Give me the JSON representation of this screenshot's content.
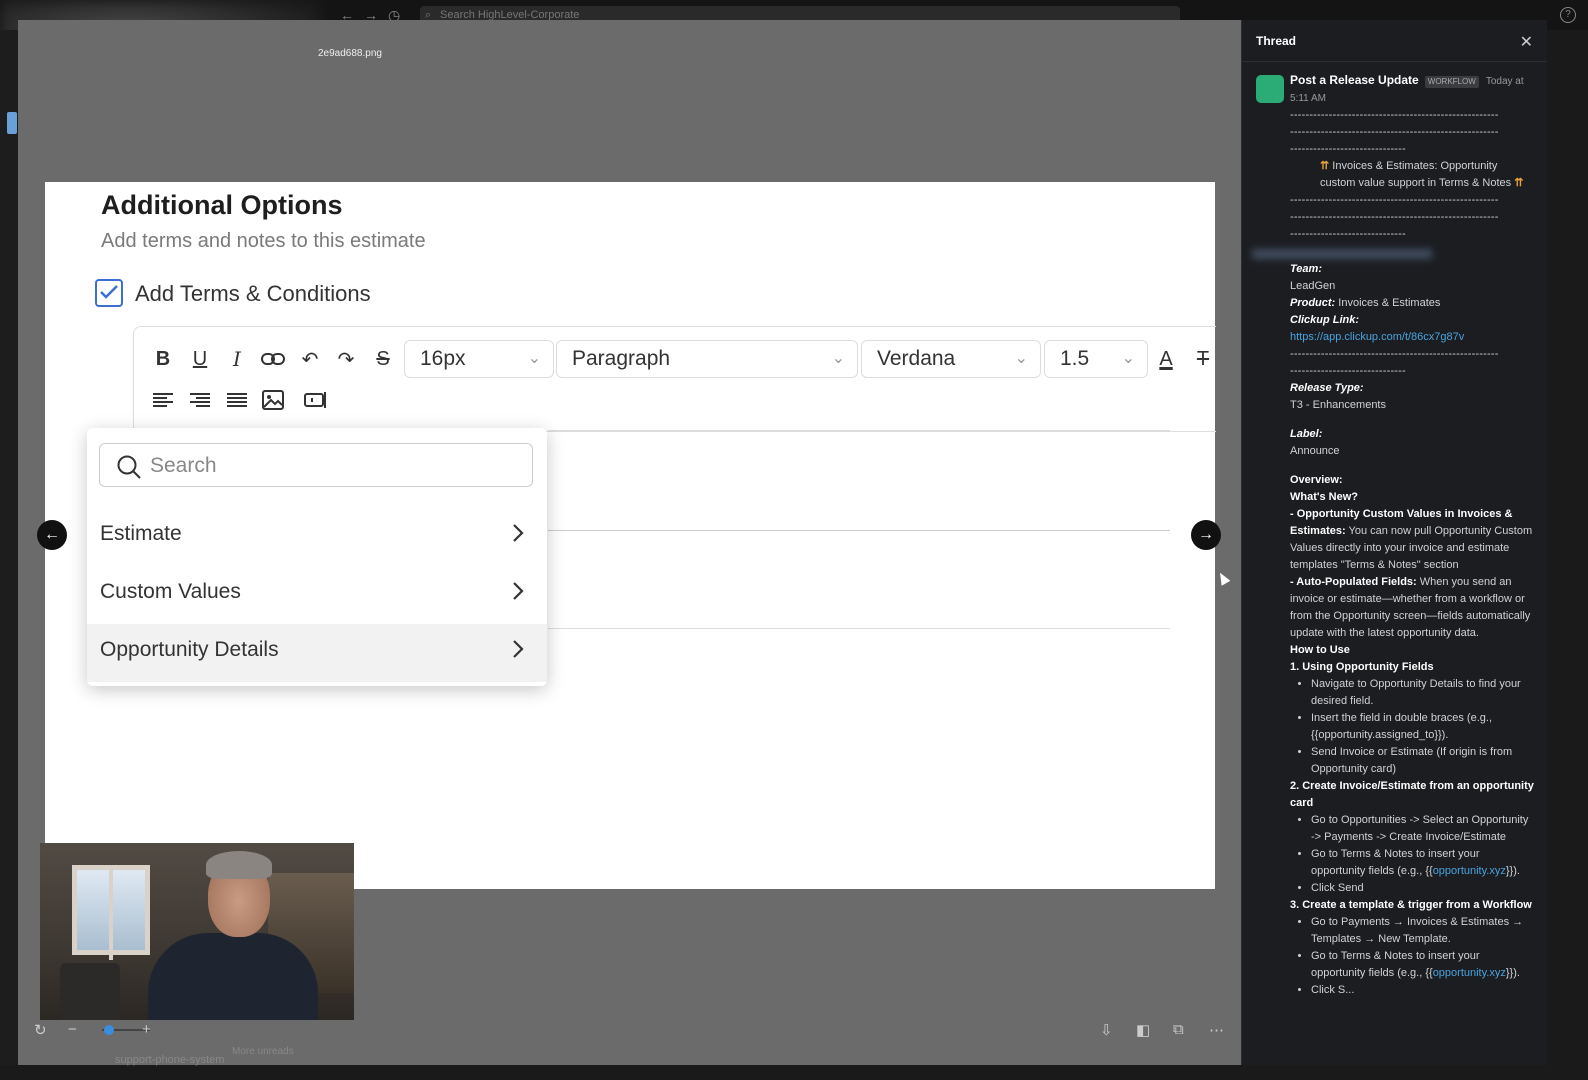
{
  "topbar": {
    "search_placeholder": "Search HighLevel-Corporate"
  },
  "viewer": {
    "file_name": "2e9ad688.png",
    "behind_text": "support-phone-system",
    "behind_text2": "More unreads"
  },
  "panel": {
    "title": "Additional Options",
    "subtitle": "Add terms and notes to this estimate",
    "checkbox_label": "Add Terms & Conditions",
    "checkbox_checked": true,
    "toolbar": {
      "font_size": "16px",
      "block_type": "Paragraph",
      "font_family": "Verdana",
      "line_height": "1.5"
    },
    "dropdown": {
      "search_placeholder": "Search",
      "items": [
        {
          "label": "Estimate"
        },
        {
          "label": "Custom Values"
        },
        {
          "label": "Opportunity Details"
        }
      ]
    }
  },
  "thread": {
    "title": "Thread",
    "sender": "Post a Release Update",
    "badge": "WORKFLOW",
    "time": "Today at 5:11 AM",
    "headline": "Invoices & Estimates: Opportunity custom value support in Terms & Notes",
    "team_label": "Team:",
    "team_value": "LeadGen",
    "product_label": "Product:",
    "product_value": "Invoices & Estimates",
    "clickup_label": "Clickup Link:",
    "clickup_value": "https://app.clickup.com/t/86cx7g87v",
    "release_type_label": "Release Type:",
    "release_type_value": "T3 - Enhancements",
    "label_label": "Label:",
    "label_value": "Announce",
    "overview": "Overview:",
    "whats_new": "What's New?",
    "feature1_title": "- Opportunity Custom Values in Invoices & Estimates:",
    "feature1_text": "You can now pull Opportunity Custom Values directly into your invoice and estimate templates \"Terms & Notes\" section",
    "feature2_title": "- Auto-Populated Fields:",
    "feature2_text": "When you send an invoice or estimate—whether from a workflow or from the Opportunity screen—fields automatically update with the latest opportunity data.",
    "how_to_use": "How to Use",
    "step1_title": "1. Using Opportunity Fields",
    "step1_items": [
      "Navigate to Opportunity Details to find your desired field.",
      "Insert the field in double braces (e.g., {{opportunity.assigned_to}}).",
      "Send Invoice or Estimate (If origin is from Opportunity card)"
    ],
    "step2_title": "2. Create Invoice/Estimate from an opportunity card",
    "step2_items": [
      "Go to Opportunities -> Select an Opportunity -> Payments -> Create Invoice/Estimate",
      "Go to Terms & Notes to insert your opportunity fields (e.g., {{",
      "Click Send"
    ],
    "step2_link": "opportunity.xyz",
    "step2_suffix": "}}).",
    "step3_title": "3. Create a template & trigger from a Workflow",
    "step3_items": [
      "Go to Payments → Invoices & Estimates → Templates → New Template.",
      "Go to Terms & Notes to insert your opportunity fields (e.g., {{"
    ],
    "step3_link": "opportunity.xyz",
    "step3_suffix": "}}).",
    "step3_cut": "Click S..."
  },
  "colors": {
    "accent_blue": "#3b6fd6",
    "link_blue": "#4aa3df",
    "thread_bg": "#1b1d21",
    "bot_green": "#2bac76"
  }
}
